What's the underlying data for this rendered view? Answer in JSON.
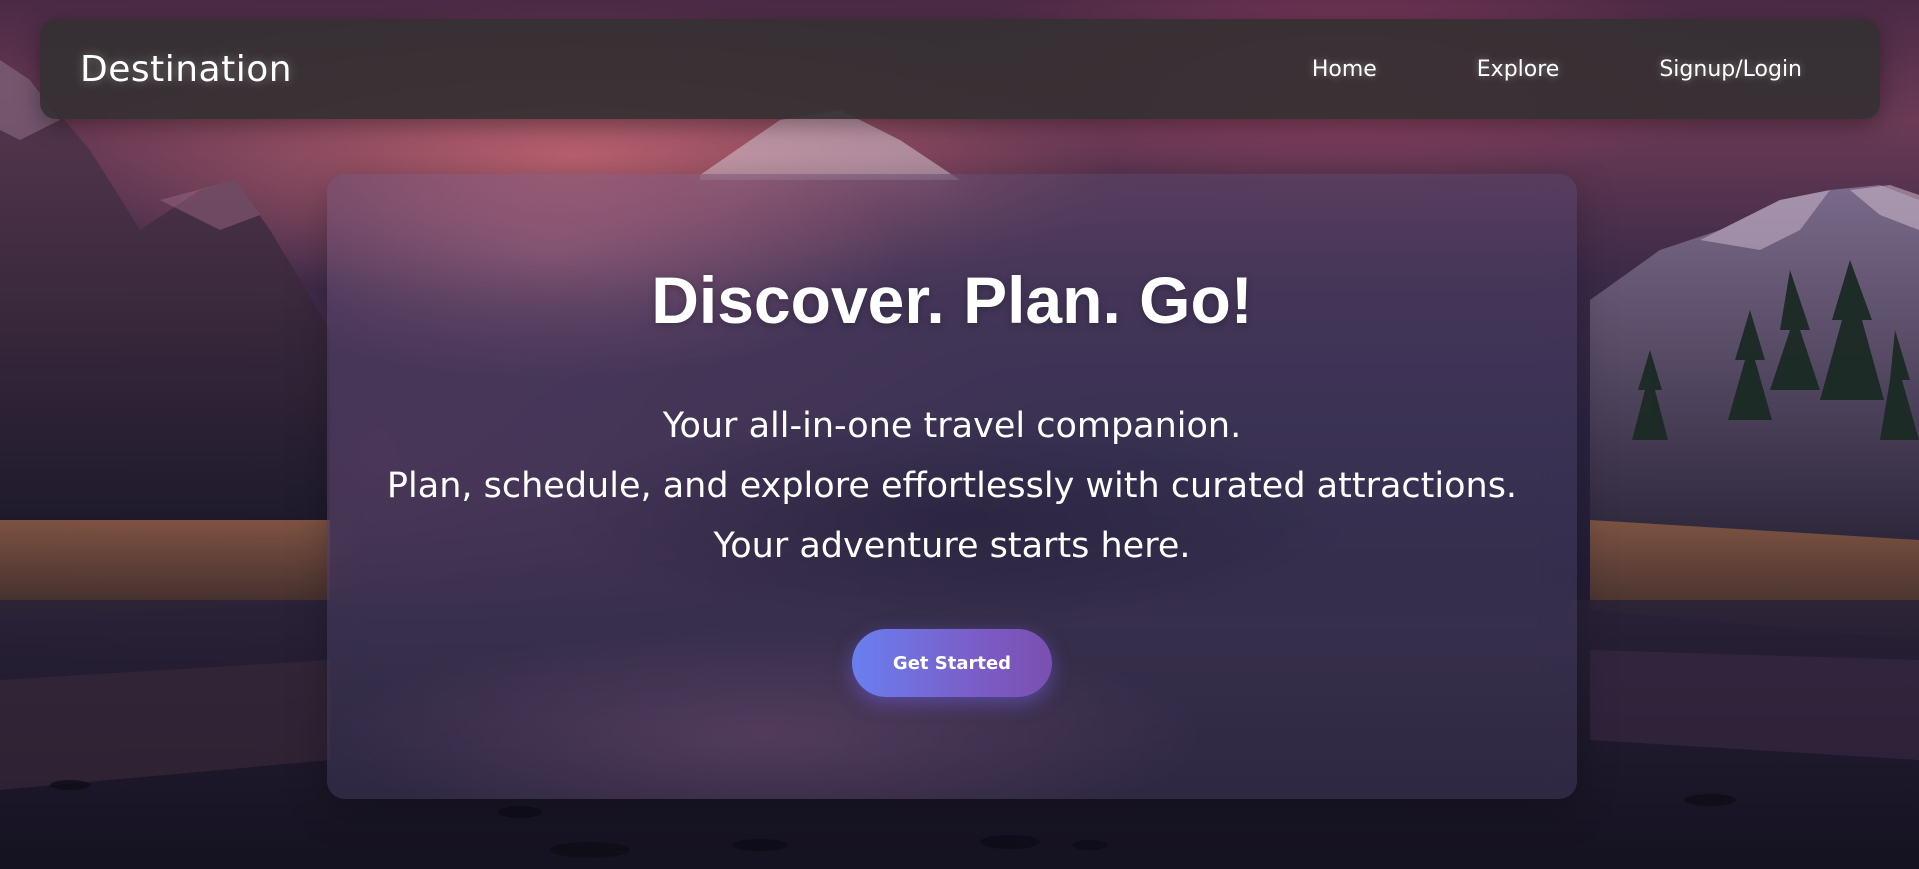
{
  "navbar": {
    "brand": "Destination",
    "links": [
      {
        "label": "Home"
      },
      {
        "label": "Explore"
      },
      {
        "label": "Signup/Login"
      }
    ]
  },
  "hero": {
    "title": "Discover. Plan. Go!",
    "lines": [
      "Your all-in-one travel companion.",
      "Plan, schedule, and explore effortlessly with curated attractions.",
      "Your adventure starts here."
    ],
    "cta_label": "Get Started"
  },
  "colors": {
    "navbar_bg": "#343032",
    "cta_gradient_start": "#6a7ff0",
    "cta_gradient_end": "#7a4fb0",
    "text": "#ffffff"
  },
  "background": {
    "image": "mountain-lake-landscape"
  }
}
